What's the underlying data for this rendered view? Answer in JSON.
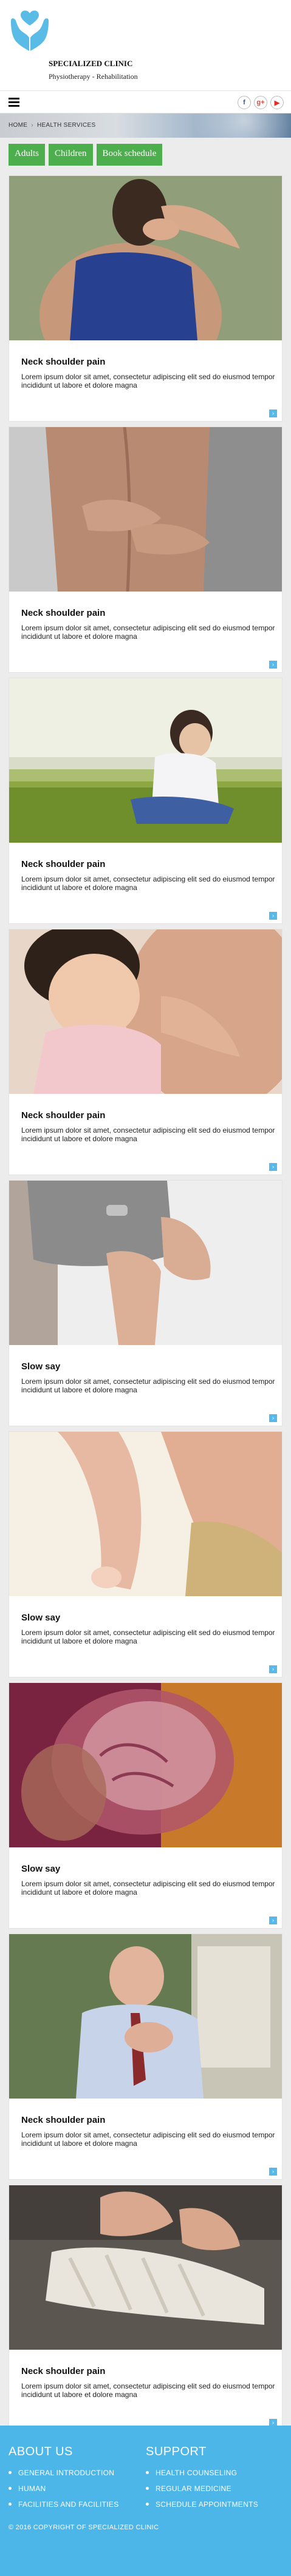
{
  "header": {
    "clinic_name": "SPECIALIZED CLINIC",
    "clinic_sub": "Physiotherapy - Rehabilitation",
    "logo_icon": "hands-heart-icon",
    "brand_color": "#5bbbe7"
  },
  "nav": {
    "menu_icon": "hamburger-icon",
    "socials": [
      {
        "name": "facebook-icon",
        "glyph": "f"
      },
      {
        "name": "google-plus-icon",
        "glyph": "g+"
      },
      {
        "name": "youtube-icon",
        "glyph": "▶"
      }
    ]
  },
  "breadcrumb": {
    "home": "HOME",
    "separator": "›",
    "current": "HEALTH SERVICES"
  },
  "tabs": [
    "Adults",
    "Children",
    "Book schedule"
  ],
  "tab_color": "#4cae4c",
  "cards": [
    {
      "title": "Neck shoulder pain",
      "desc": "Lorem ipsum dolor sit amet, consectetur adipiscing elit sed do eiusmod tempor incididunt ut labore et dolore magna",
      "image": "woman-neck-pain"
    },
    {
      "title": "Neck shoulder pain",
      "desc": "Lorem ipsum dolor sit amet, consectetur adipiscing elit sed do eiusmod tempor incididunt ut labore et dolore magna",
      "image": "back-pain"
    },
    {
      "title": "Neck shoulder pain",
      "desc": "Lorem ipsum dolor sit amet, consectetur adipiscing elit sed do eiusmod tempor incididunt ut labore et dolore magna",
      "image": "child-on-grass"
    },
    {
      "title": "Neck shoulder pain",
      "desc": "Lorem ipsum dolor sit amet, consectetur adipiscing elit sed do eiusmod tempor incididunt ut labore et dolore magna",
      "image": "mother-and-child"
    },
    {
      "title": "Slow say",
      "desc": "Lorem ipsum dolor sit amet, consectetur adipiscing elit sed do eiusmod tempor incididunt ut labore et dolore magna",
      "image": "knee-pain"
    },
    {
      "title": "Slow say",
      "desc": "Lorem ipsum dolor sit amet, consectetur adipiscing elit sed do eiusmod tempor incididunt ut labore et dolore magna",
      "image": "foot-heel-pain"
    },
    {
      "title": "Slow say",
      "desc": "Lorem ipsum dolor sit amet, consectetur adipiscing elit sed do eiusmod tempor incididunt ut labore et dolore magna",
      "image": "headache-brain"
    },
    {
      "title": "Neck shoulder pain",
      "desc": "Lorem ipsum dolor sit amet, consectetur adipiscing elit sed do eiusmod tempor incididunt ut labore et dolore magna",
      "image": "man-chest-pain"
    },
    {
      "title": "Neck shoulder pain",
      "desc": "Lorem ipsum dolor sit amet, consectetur adipiscing elit sed do eiusmod tempor incididunt ut labore et dolore magna",
      "image": "bandaged-foot"
    }
  ],
  "card_more_glyph": "›",
  "footer": {
    "about_title": "ABOUT US",
    "about_items": [
      "GENERAL INTRODUCTION",
      "HUMAN",
      "FACILITIES AND FACILITIES"
    ],
    "support_title": "SUPPORT",
    "support_items": [
      "HEALTH COUNSELING",
      "REGULAR MEDICINE",
      "SCHEDULE APPOINTMENTS"
    ],
    "copyright": "© 2016 COPYRIGHT OF SPECIALIZED CLINIC",
    "bg_color": "#4db6e8"
  }
}
